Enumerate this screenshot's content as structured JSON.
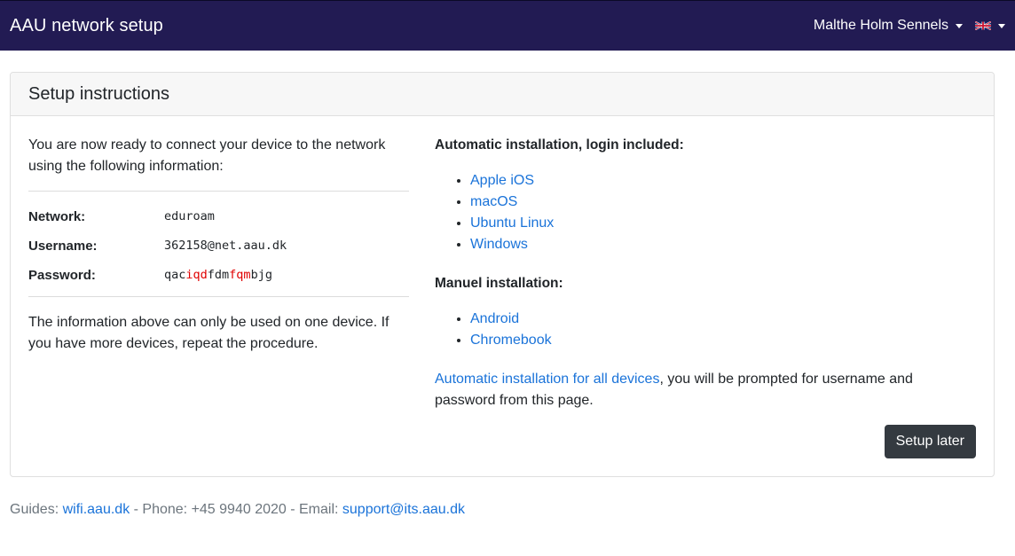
{
  "navbar": {
    "brand": "AAU network setup",
    "user_name": "Malthe Holm Sennels",
    "language_icon": "uk-flag-icon"
  },
  "card": {
    "title": "Setup instructions",
    "intro": "You are now ready to connect your device to the network using the following information:",
    "network_label": "Network:",
    "network_value": "eduroam",
    "username_label": "Username:",
    "username_value": "362158@net.aau.dk",
    "password_label": "Password:",
    "password_parts": [
      "qac",
      "iqd",
      "fdm",
      "fqm",
      "bjg"
    ],
    "note": "The information above can only be used on one device. If you have more devices, repeat the procedure.",
    "auto_title": "Automatic installation, login included:",
    "auto_links": [
      "Apple iOS",
      "macOS",
      "Ubuntu Linux",
      "Windows"
    ],
    "manual_title": "Manuel installation:",
    "manual_links": [
      "Android",
      "Chromebook"
    ],
    "all_devices_link": "Automatic installation for all devices",
    "all_devices_text": ", you will be prompted for username and password from this page.",
    "setup_later_label": "Setup later"
  },
  "footer": {
    "guides_label": "Guides: ",
    "guides_link": "wifi.aau.dk",
    "phone_text": " - Phone: +45 9940 2020 - Email: ",
    "email_link": "support@its.aau.dk"
  },
  "colors": {
    "navbar_bg": "#221b53",
    "link": "#1a73d9",
    "password_highlight": "#e00000",
    "button_bg": "#343a40"
  }
}
